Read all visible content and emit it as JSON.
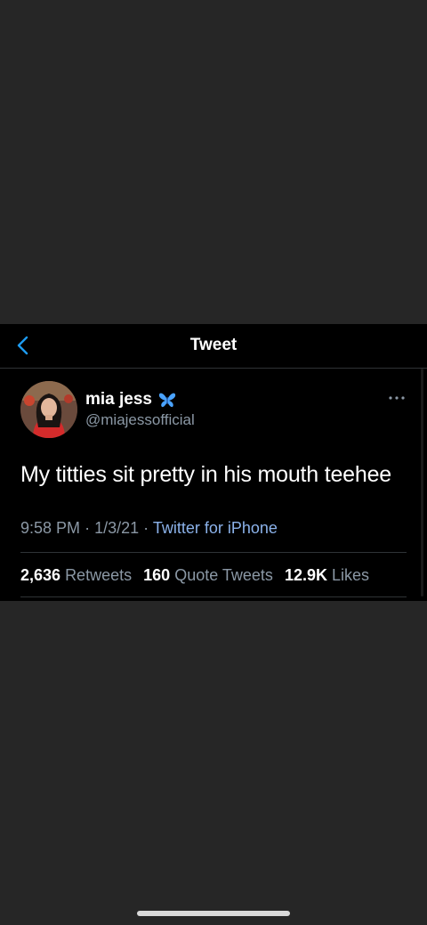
{
  "navbar": {
    "title": "Tweet",
    "back_icon": "chevron-left-icon"
  },
  "author": {
    "name": "mia jess",
    "handle": "@miajessofficial",
    "badge_icon": "butterfly-icon"
  },
  "tweet": {
    "text": "My titties sit pretty in his mouth teehee",
    "time": "9:58 PM",
    "date": "1/3/21",
    "separator": "·",
    "source": "Twitter for iPhone"
  },
  "stats": [
    {
      "value": "2,636",
      "label": "Retweets"
    },
    {
      "value": "160",
      "label": "Quote Tweets"
    },
    {
      "value": "12.9K",
      "label": "Likes"
    }
  ],
  "colors": {
    "background": "#000000",
    "outer_background": "#262626",
    "link": "#8bb2ea",
    "secondary_text": "#8b98a5",
    "accent": "#1d9bf0"
  }
}
